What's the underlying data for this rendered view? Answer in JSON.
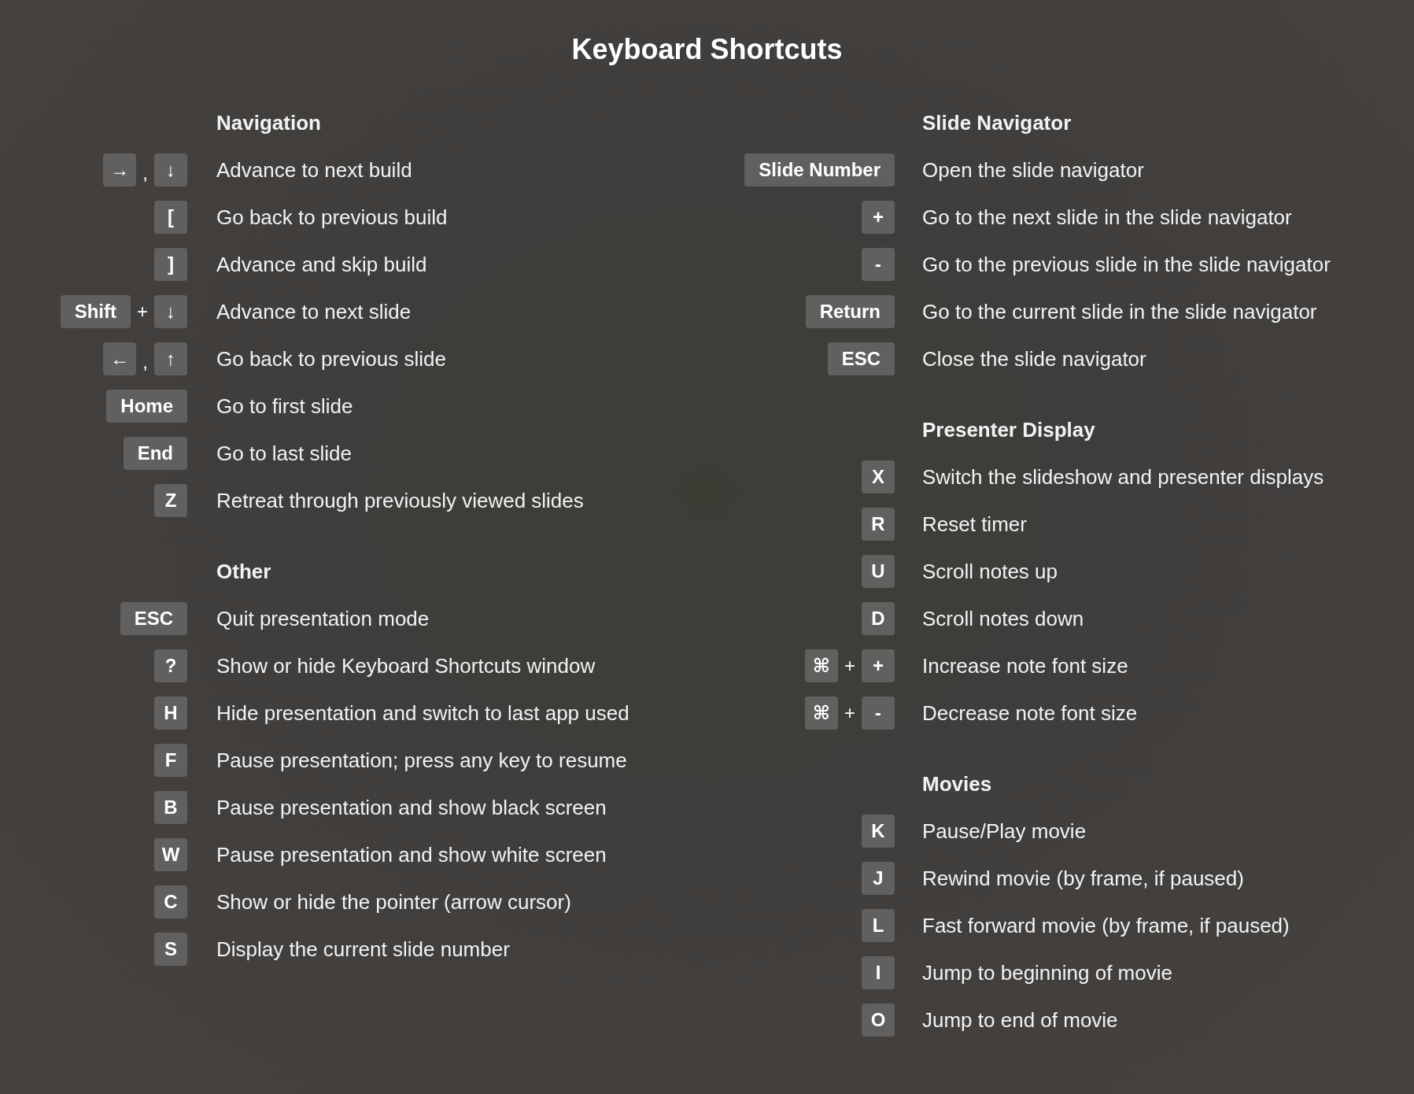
{
  "title": "Keyboard Shortcuts",
  "columns": [
    {
      "sections": [
        {
          "heading": "Navigation",
          "shortcuts": [
            {
              "keys": [
                {
                  "kind": "key",
                  "label": "→"
                },
                {
                  "kind": "sep",
                  "label": ","
                },
                {
                  "kind": "key",
                  "label": "↓"
                }
              ],
              "description": "Advance to next build"
            },
            {
              "keys": [
                {
                  "kind": "key",
                  "label": "["
                }
              ],
              "description": "Go back to previous build"
            },
            {
              "keys": [
                {
                  "kind": "key",
                  "label": "]"
                }
              ],
              "description": "Advance and skip build"
            },
            {
              "keys": [
                {
                  "kind": "key",
                  "label": "Shift"
                },
                {
                  "kind": "sep",
                  "label": "+"
                },
                {
                  "kind": "key",
                  "label": "↓"
                }
              ],
              "description": "Advance to next slide"
            },
            {
              "keys": [
                {
                  "kind": "key",
                  "label": "←"
                },
                {
                  "kind": "sep",
                  "label": ","
                },
                {
                  "kind": "key",
                  "label": "↑"
                }
              ],
              "description": "Go back to previous slide"
            },
            {
              "keys": [
                {
                  "kind": "key",
                  "label": "Home"
                }
              ],
              "description": "Go to first slide"
            },
            {
              "keys": [
                {
                  "kind": "key",
                  "label": "End"
                }
              ],
              "description": "Go to last slide"
            },
            {
              "keys": [
                {
                  "kind": "key",
                  "label": "Z"
                }
              ],
              "description": "Retreat through previously viewed slides"
            }
          ]
        },
        {
          "heading": "Other",
          "shortcuts": [
            {
              "keys": [
                {
                  "kind": "key",
                  "label": "ESC"
                }
              ],
              "description": "Quit presentation mode"
            },
            {
              "keys": [
                {
                  "kind": "key",
                  "label": "?"
                }
              ],
              "description": "Show or hide Keyboard Shortcuts window"
            },
            {
              "keys": [
                {
                  "kind": "key",
                  "label": "H"
                }
              ],
              "description": "Hide presentation and switch to last app used"
            },
            {
              "keys": [
                {
                  "kind": "key",
                  "label": "F"
                }
              ],
              "description": "Pause presentation; press any key to resume"
            },
            {
              "keys": [
                {
                  "kind": "key",
                  "label": "B"
                }
              ],
              "description": "Pause presentation and show black screen"
            },
            {
              "keys": [
                {
                  "kind": "key",
                  "label": "W"
                }
              ],
              "description": "Pause presentation and show white screen"
            },
            {
              "keys": [
                {
                  "kind": "key",
                  "label": "C"
                }
              ],
              "description": "Show or hide the pointer (arrow cursor)"
            },
            {
              "keys": [
                {
                  "kind": "key",
                  "label": "S"
                }
              ],
              "description": "Display the current slide number"
            }
          ]
        }
      ]
    },
    {
      "sections": [
        {
          "heading": "Slide Navigator",
          "shortcuts": [
            {
              "keys": [
                {
                  "kind": "key",
                  "label": "Slide Number"
                }
              ],
              "description": "Open the slide navigator"
            },
            {
              "keys": [
                {
                  "kind": "key",
                  "label": "+"
                }
              ],
              "description": "Go to the next slide in the slide navigator"
            },
            {
              "keys": [
                {
                  "kind": "key",
                  "label": "-"
                }
              ],
              "description": "Go to the previous slide in the slide navigator"
            },
            {
              "keys": [
                {
                  "kind": "key",
                  "label": "Return"
                }
              ],
              "description": "Go to the current slide in the slide navigator"
            },
            {
              "keys": [
                {
                  "kind": "key",
                  "label": "ESC"
                }
              ],
              "description": "Close the slide navigator"
            }
          ]
        },
        {
          "heading": "Presenter Display",
          "shortcuts": [
            {
              "keys": [
                {
                  "kind": "key",
                  "label": "X"
                }
              ],
              "description": "Switch the slideshow and presenter displays"
            },
            {
              "keys": [
                {
                  "kind": "key",
                  "label": "R"
                }
              ],
              "description": "Reset timer"
            },
            {
              "keys": [
                {
                  "kind": "key",
                  "label": "U"
                }
              ],
              "description": "Scroll notes up"
            },
            {
              "keys": [
                {
                  "kind": "key",
                  "label": "D"
                }
              ],
              "description": "Scroll notes down"
            },
            {
              "keys": [
                {
                  "kind": "key",
                  "label": "⌘"
                },
                {
                  "kind": "sep",
                  "label": "+"
                },
                {
                  "kind": "key",
                  "label": "+"
                }
              ],
              "description": "Increase note font size"
            },
            {
              "keys": [
                {
                  "kind": "key",
                  "label": "⌘"
                },
                {
                  "kind": "sep",
                  "label": "+"
                },
                {
                  "kind": "key",
                  "label": "-"
                }
              ],
              "description": "Decrease note font size"
            }
          ]
        },
        {
          "heading": "Movies",
          "shortcuts": [
            {
              "keys": [
                {
                  "kind": "key",
                  "label": "K"
                }
              ],
              "description": "Pause/Play movie"
            },
            {
              "keys": [
                {
                  "kind": "key",
                  "label": "J"
                }
              ],
              "description": "Rewind movie (by frame, if paused)"
            },
            {
              "keys": [
                {
                  "kind": "key",
                  "label": "L"
                }
              ],
              "description": "Fast forward movie (by frame, if paused)"
            },
            {
              "keys": [
                {
                  "kind": "key",
                  "label": "I"
                }
              ],
              "description": "Jump to beginning of movie"
            },
            {
              "keys": [
                {
                  "kind": "key",
                  "label": "O"
                }
              ],
              "description": "Jump to end of movie"
            }
          ]
        }
      ]
    }
  ]
}
